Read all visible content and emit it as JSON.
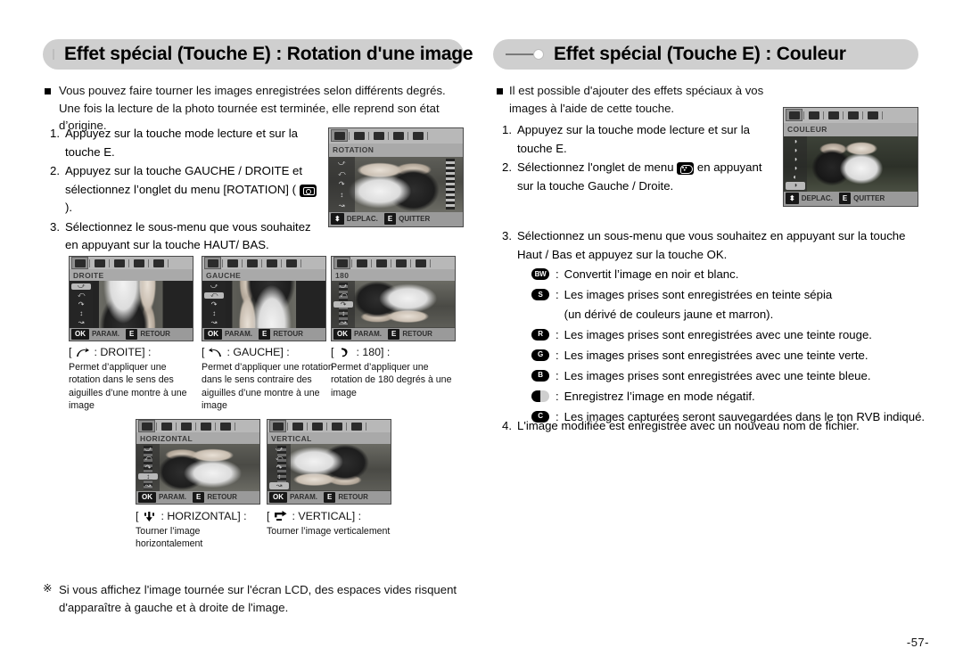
{
  "page": {
    "number": "-57-"
  },
  "left": {
    "header": "Effet spécial (Touche E) : Rotation d'une image",
    "intro": "Vous pouvez faire tourner les images enregistrées selon différents degrés. Une fois la lecture de la photo tournée est terminée, elle reprend son état d’origine.",
    "steps": [
      {
        "num": "1.",
        "text": "Appuyez sur la touche mode lecture et sur la touche E."
      },
      {
        "num": "2.",
        "text_before": "Appuyez sur la touche GAUCHE / DROITE et sélectionnez l’onglet du menu [ROTATION] (",
        "text_after": ")."
      },
      {
        "num": "3.",
        "text": "Sélectionnez le sous-menu que vous souhaitez en appuyant sur la touche HAUT/ BAS."
      }
    ],
    "lcd_main": {
      "title": "ROTATION",
      "bar_key1": "",
      "bar_label1": "DEPLAC.",
      "bar_key2": "E",
      "bar_label2": "QUITTER"
    },
    "lcd_small": [
      {
        "title": "DROITE",
        "ok": "OK",
        "param": "PARAM.",
        "e": "E",
        "retour": "RETOUR"
      },
      {
        "title": "GAUCHE",
        "ok": "OK",
        "param": "PARAM.",
        "e": "E",
        "retour": "RETOUR"
      },
      {
        "title": "180",
        "ok": "OK",
        "param": "PARAM.",
        "e": "E",
        "retour": "RETOUR"
      },
      {
        "title": "HORIZONTAL",
        "ok": "OK",
        "param": "PARAM.",
        "e": "E",
        "retour": "RETOUR"
      },
      {
        "title": "VERTICAL",
        "ok": "OK",
        "param": "PARAM.",
        "e": "E",
        "retour": "RETOUR"
      }
    ],
    "captions": [
      {
        "head": "[",
        "name": ": DROITE] :",
        "body": "Permet d’appliquer une rotation dans le sens des aiguilles d’une montre à une image"
      },
      {
        "head": "[",
        "name": ": GAUCHE] :",
        "body": "Permet d’appliquer une rotation dans le sens contraire des aiguilles d’une montre à une image"
      },
      {
        "head": "[",
        "name": ": 180] :",
        "body": "Permet d’appliquer une rotation de 180 degrés à une image"
      },
      {
        "head": "[",
        "name": ": HORIZONTAL] :",
        "body": "Tourner l’image horizontalement"
      },
      {
        "head": "[",
        "name": ": VERTICAL] :",
        "body": "Tourner l’image verticalement"
      }
    ],
    "note": "Si vous affichez l'image tournée sur l'écran LCD, des espaces vides risquent d'apparaître à gauche et à droite de l'image."
  },
  "right": {
    "header": "Effet spécial (Touche E) : Couleur",
    "intro": "Il est possible d'ajouter des effets spéciaux à vos images à l'aide de cette touche.",
    "steps": [
      {
        "num": "1.",
        "text": "Appuyez sur la touche mode lecture et sur la touche E."
      },
      {
        "num": "2.",
        "text_before": "Sélectionnez l'onglet de menu",
        "text_after": "en appuyant sur la touche Gauche / Droite."
      }
    ],
    "step3": {
      "num": "3.",
      "text": "Sélectionnez un sous-menu que vous souhaitez en appuyant sur la touche Haut / Bas et appuyez sur la touche OK."
    },
    "step4": {
      "num": "4.",
      "text": "L'image modifiée est enregistrée avec un nouveau nom de fichier."
    },
    "legend": [
      {
        "badge": "BW",
        "text": "Convertit l’image en noir et blanc.",
        "sub": ""
      },
      {
        "badge": "S",
        "text": "Les images prises sont enregistrées en teinte sépia",
        "sub": "(un dérivé de couleurs jaune et marron)."
      },
      {
        "badge": "R",
        "text": "Les images prises sont enregistrées avec une teinte rouge.",
        "sub": ""
      },
      {
        "badge": "G",
        "text": "Les images prises sont enregistrées avec une teinte verte.",
        "sub": ""
      },
      {
        "badge": "B",
        "text": "Les images prises sont enregistrées avec une teinte bleue.",
        "sub": ""
      },
      {
        "badge": "",
        "text": "Enregistrez l’image en mode négatif.",
        "sub": "",
        "neg": true
      },
      {
        "badge": "C",
        "text": "Les images capturées seront sauvegardées dans le ton RVB indiqué.",
        "sub": ""
      }
    ],
    "lcd_main": {
      "title": "COULEUR",
      "bar_label1": "DEPLAC.",
      "bar_key2": "E",
      "bar_label2": "QUITTER"
    }
  },
  "colors": {
    "header_bg": "#cfcfcf",
    "lcd_tab_bg": "#b8b8b8",
    "lcd_title_bg": "#a9a9a9",
    "lcd_bar_bg": "#9a9a9a",
    "text": "#111111"
  }
}
